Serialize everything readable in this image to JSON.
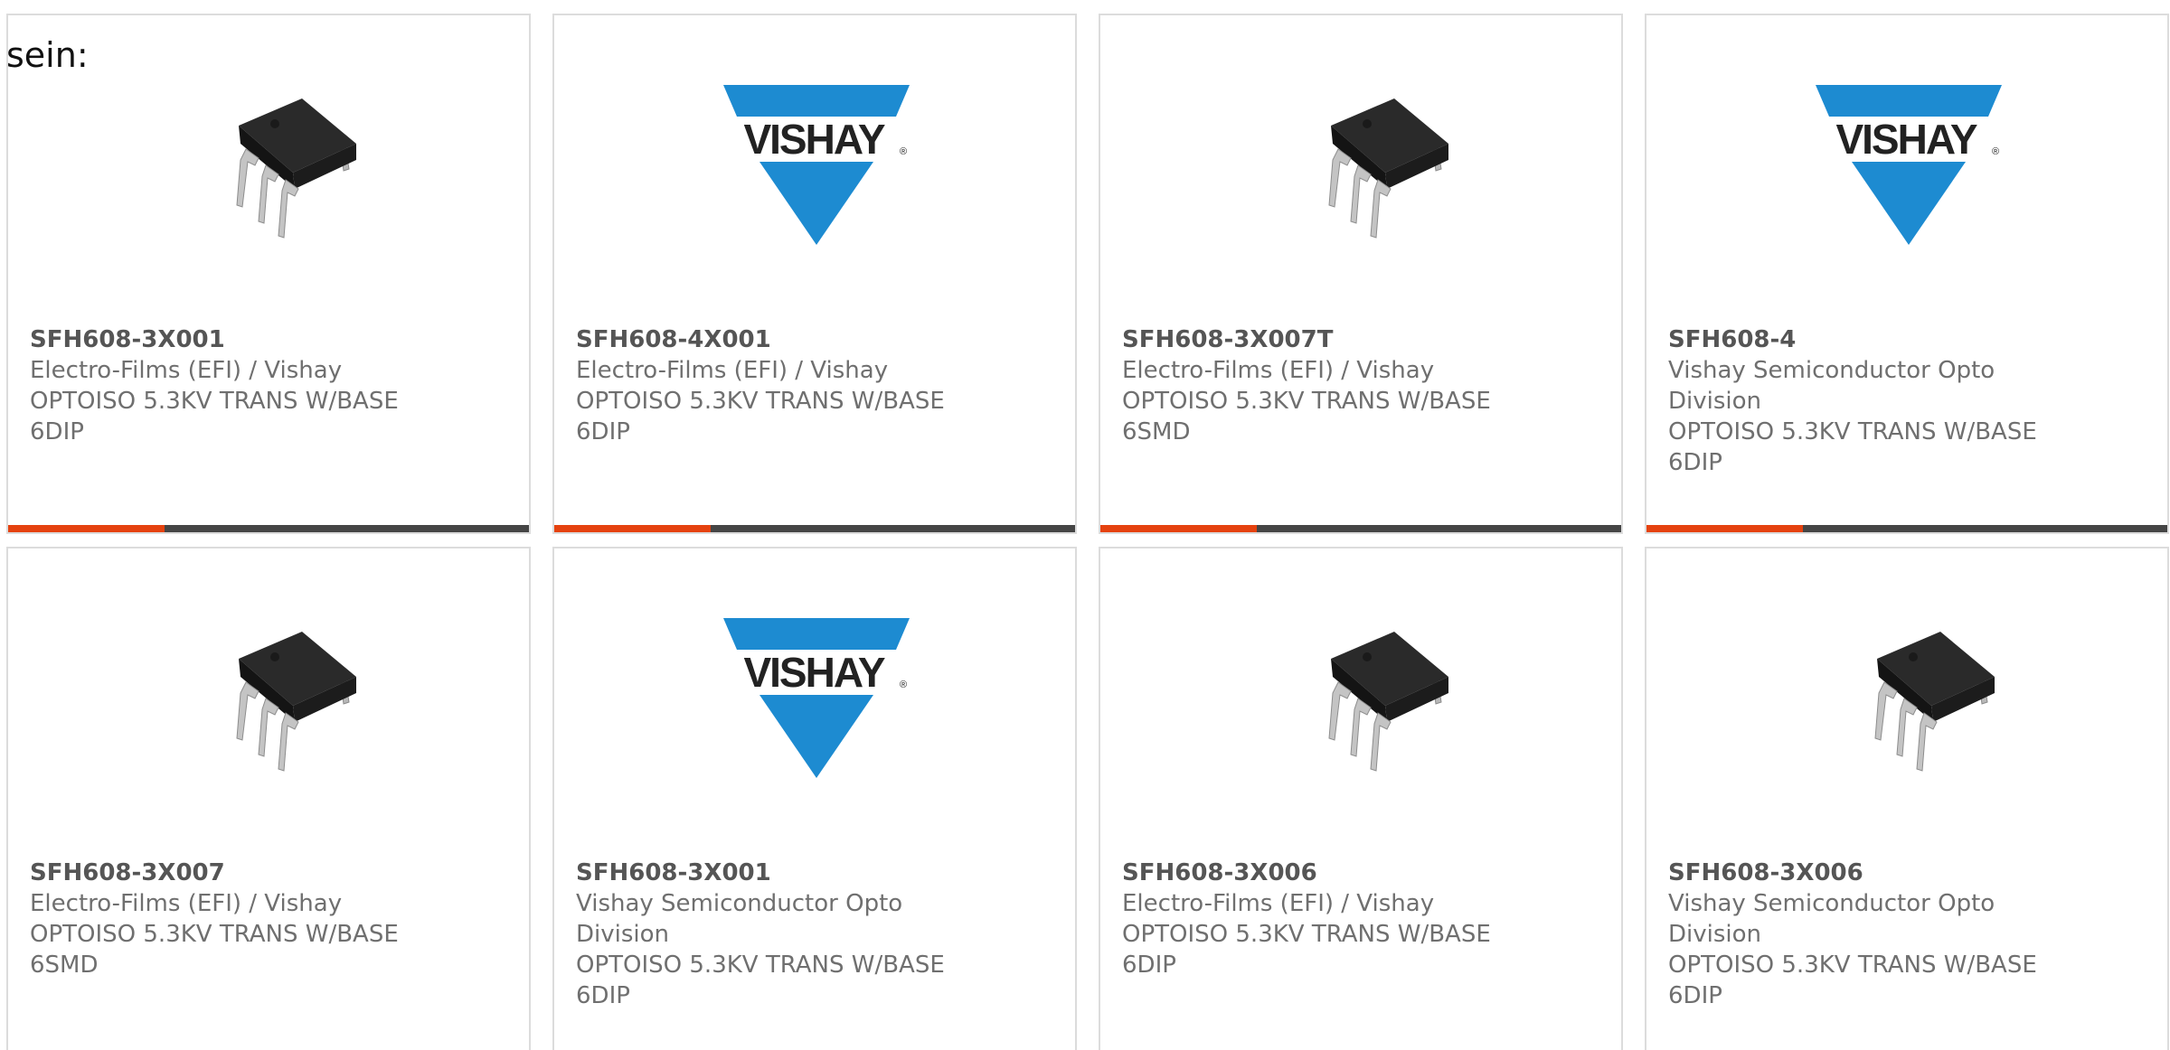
{
  "intro_text": "sein:",
  "colors": {
    "accent": "#e5420f",
    "bar_track": "#454545",
    "vishay_blue": "#1d8bd1",
    "text_gray": "#6f6f6f"
  },
  "products": [
    {
      "part_number": "SFH608-3X001",
      "manufacturer": "Electro-Films (EFI) / Vishay",
      "description": "OPTOISO 5.3KV TRANS W/BASE 6DIP",
      "image": "dip-chip-icon",
      "progress": 0.3
    },
    {
      "part_number": "SFH608-4X001",
      "manufacturer": "Electro-Films (EFI) / Vishay",
      "description": "OPTOISO 5.3KV TRANS W/BASE 6DIP",
      "image": "vishay-logo",
      "progress": 0.3
    },
    {
      "part_number": "SFH608-3X007T",
      "manufacturer": "Electro-Films (EFI) / Vishay",
      "description": "OPTOISO 5.3KV TRANS W/BASE 6SMD",
      "image": "dip-chip-icon",
      "progress": 0.3
    },
    {
      "part_number": "SFH608-4",
      "manufacturer": "Vishay Semiconductor Opto Division",
      "description": "OPTOISO 5.3KV TRANS W/BASE 6DIP",
      "image": "vishay-logo",
      "progress": 0.3
    },
    {
      "part_number": "SFH608-3X007",
      "manufacturer": "Electro-Films (EFI) / Vishay",
      "description": "OPTOISO 5.3KV TRANS W/BASE 6SMD",
      "image": "dip-chip-icon"
    },
    {
      "part_number": "SFH608-3X001",
      "manufacturer": "Vishay Semiconductor Opto Division",
      "description": "OPTOISO 5.3KV TRANS W/BASE 6DIP",
      "image": "vishay-logo"
    },
    {
      "part_number": "SFH608-3X006",
      "manufacturer": "Electro-Films (EFI) / Vishay",
      "description": "OPTOISO 5.3KV TRANS W/BASE 6DIP",
      "image": "dip-chip-icon"
    },
    {
      "part_number": "SFH608-3X006",
      "manufacturer": "Vishay Semiconductor Opto Division",
      "description": "OPTOISO 5.3KV TRANS W/BASE 6DIP",
      "image": "dip-chip-icon"
    }
  ],
  "logo": {
    "brand_text": "VISHAY"
  }
}
